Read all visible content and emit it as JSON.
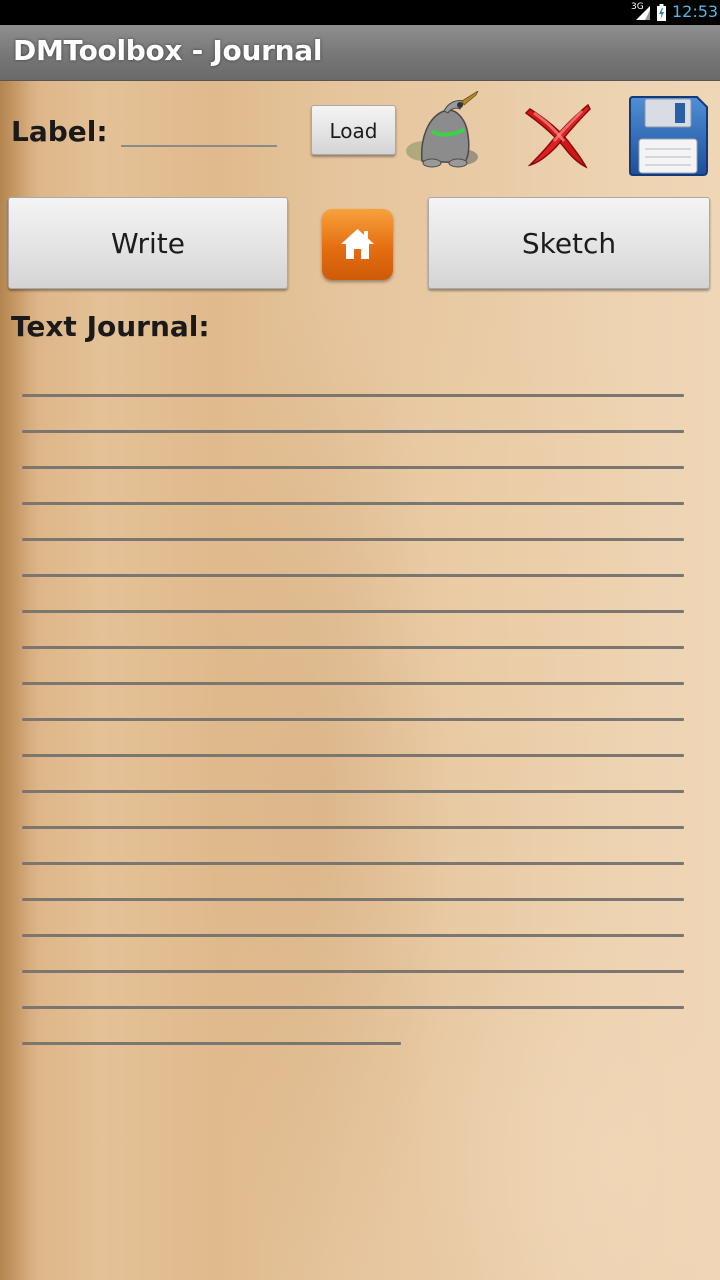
{
  "status_bar": {
    "network_type": "3G",
    "time": "12:53",
    "colors": {
      "time": "#4fb8e6"
    }
  },
  "action_bar": {
    "title": "DMToolbox - Journal"
  },
  "label_row": {
    "caption": "Label:",
    "input_value": "",
    "load_button_label": "Load",
    "icons": [
      "mole-icon",
      "close-icon",
      "save-icon"
    ]
  },
  "mode_row": {
    "write_label": "Write",
    "home_icon": "home-icon",
    "sketch_label": "Sketch",
    "colors": {
      "home_button": "#e56e12"
    }
  },
  "journal": {
    "caption": "Text Journal:",
    "text": ""
  }
}
